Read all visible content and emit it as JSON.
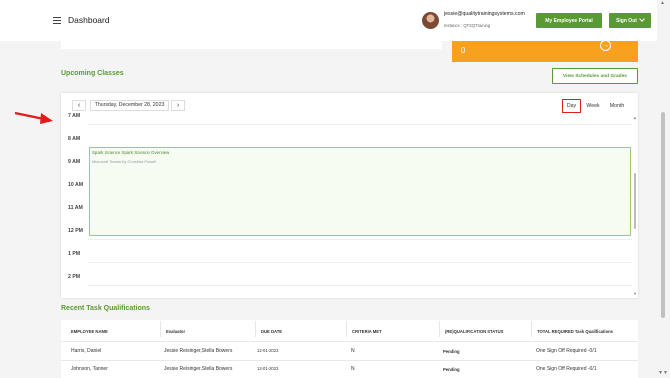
{
  "header": {
    "title": "Dashboard",
    "user_email": "jessie@qualitytrainingsystems.com",
    "instance": "Instance : QTSQTraining",
    "portal_button": "My Employee Portal",
    "signout_button": "Sign Out"
  },
  "summary": {
    "orange_value": "0",
    "orange_arrow": "→"
  },
  "upcoming": {
    "title": "Upcoming Classes",
    "view_button": "View Schedules and Grades",
    "calendar": {
      "prev": "‹",
      "next": "›",
      "date": "Thursday, December 28, 2023",
      "views": [
        "Day",
        "Week",
        "Month"
      ],
      "active_view": "Day",
      "hours": [
        "7 AM",
        "8 AM",
        "9 AM",
        "10 AM",
        "11 AM",
        "12 PM",
        "1 PM",
        "2 PM"
      ],
      "event": {
        "title": "Spark Science Spark Science Overview",
        "subtitle": "Microsoft Teams by Christina Powell"
      }
    }
  },
  "tasks": {
    "title": "Recent Task Qualifications",
    "columns": [
      "EMPLOYEE NAME",
      "Evaluator",
      "DUE DATE",
      "CRITERIA MET",
      "(RE)QUALIFICATION STATUS",
      "TOTAL REQUIRED Task Qualifications"
    ],
    "rows": [
      {
        "employee": "Harris, Daniel",
        "evaluator": "Jessie Reisinger,Stella Bowers",
        "due": "12-01-2023",
        "criteria": "N",
        "status": "Pending",
        "total": "One Sign Off Required -0/1"
      },
      {
        "employee": "Johnson, Tanner",
        "evaluator": "Jessie Reisinger,Stella Bowers",
        "due": "12-01-2023",
        "criteria": "N",
        "status": "Pending",
        "total": "One Sign Off Required -0/1"
      }
    ]
  },
  "colors": {
    "green": "#5a9a34",
    "orange": "#f7a11f",
    "highlight_red": "#d9221c"
  }
}
